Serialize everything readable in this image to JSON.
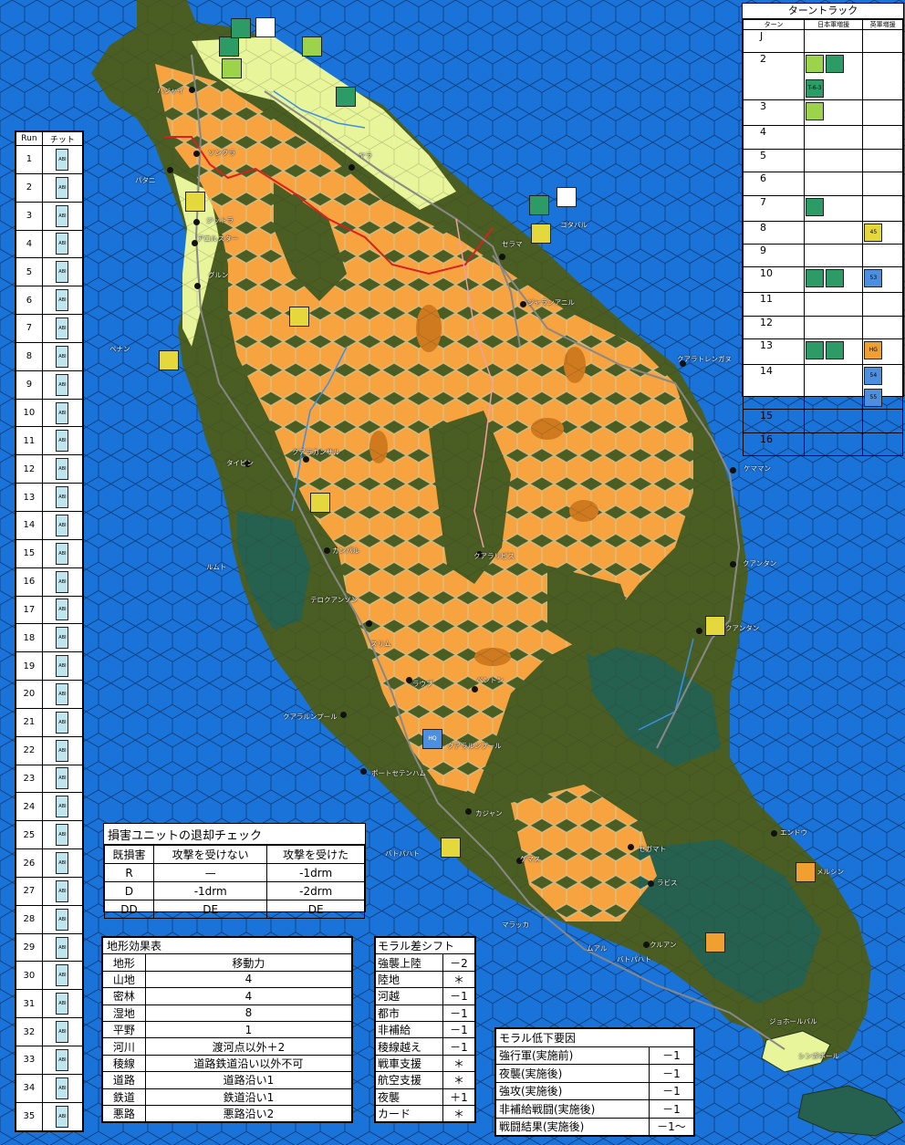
{
  "colors": {
    "sea": "#1a73d9",
    "jungle": "#4a5d23",
    "dense": "#26604e",
    "open": "#e8f59a",
    "mountain": "#f7a340",
    "ridge": "#d07a1f"
  },
  "run_table": {
    "header_run": "Run",
    "header_chit": "チット",
    "chit_label": "ABI",
    "rows": [
      "1",
      "2",
      "3",
      "4",
      "5",
      "6",
      "7",
      "8",
      "9",
      "10",
      "11",
      "12",
      "13",
      "14",
      "15",
      "16",
      "17",
      "18",
      "19",
      "20",
      "21",
      "22",
      "23",
      "24",
      "25",
      "26",
      "27",
      "28",
      "29",
      "30",
      "31",
      "32",
      "33",
      "34",
      "35"
    ]
  },
  "turn_track": {
    "title": "ターントラック",
    "headers": [
      "ターン",
      "日本軍増援",
      "英軍増援"
    ],
    "turns": [
      "J",
      "2",
      "3",
      "4",
      "5",
      "6",
      "7",
      "8",
      "9",
      "10",
      "11",
      "12",
      "13",
      "14",
      "15",
      "16"
    ],
    "units": {
      "row2_jp": [
        "T-6-3"
      ],
      "row8_uk": [
        "45"
      ],
      "row10_uk": [
        "53"
      ],
      "row13_uk": [
        "HG"
      ],
      "row14_uk": [
        "54",
        "55"
      ]
    }
  },
  "damage_chart": {
    "title": "損害ユニットの退却チェック",
    "headers": [
      "既損害",
      "攻撃を受けない",
      "攻撃を受けた"
    ],
    "rows": [
      [
        "R",
        "—",
        "-1drm"
      ],
      [
        "D",
        "-1drm",
        "-2drm"
      ],
      [
        "DD",
        "DE",
        "DE"
      ]
    ]
  },
  "terrain_chart": {
    "title": "地形効果表",
    "headers": [
      "地形",
      "移動力"
    ],
    "rows": [
      [
        "山地",
        "4"
      ],
      [
        "密林",
        "4"
      ],
      [
        "湿地",
        "8"
      ],
      [
        "平野",
        "1"
      ],
      [
        "河川",
        "渡河点以外＋2"
      ],
      [
        "稜線",
        "道路鉄道沿い以外不可"
      ],
      [
        "道路",
        "道路沿い1"
      ],
      [
        "鉄道",
        "鉄道沿い1"
      ],
      [
        "悪路",
        "悪路沿い2"
      ]
    ]
  },
  "morale_shift": {
    "title": "モラル差シフト",
    "rows": [
      [
        "強襲上陸",
        "－2"
      ],
      [
        "陸地",
        "＊"
      ],
      [
        "河越",
        "－1"
      ],
      [
        "都市",
        "－1"
      ],
      [
        "非補給",
        "－1"
      ],
      [
        "稜線越え",
        "－1"
      ],
      [
        "戦車支援",
        "＊"
      ],
      [
        "航空支援",
        "＊"
      ],
      [
        "夜襲",
        "＋1"
      ],
      [
        "カード",
        "＊"
      ]
    ]
  },
  "morale_reduction": {
    "title": "モラル低下要因",
    "rows": [
      [
        "強行軍(実施前)",
        "－1"
      ],
      [
        "夜襲(実施後)",
        "－1"
      ],
      [
        "強攻(実施後)",
        "－1"
      ],
      [
        "非補給戦闘(実施後)",
        "－1"
      ],
      [
        "戦闘結果(実施後)",
        "－1～"
      ]
    ]
  },
  "map": {
    "towns": [
      "ハジャイ",
      "ソンクラ",
      "パタニ",
      "コタバル",
      "ゲマス",
      "ジットラ",
      "アロルスター",
      "ペナン",
      "クアラカンサル",
      "タイピン",
      "イポー",
      "カンパル",
      "ルムト",
      "テロクアンソン",
      "スリム",
      "クアラルンプール",
      "ポートセテンハム",
      "マラッカ",
      "バトパハト",
      "ムアル",
      "クルアン",
      "ジョホールバル",
      "シンガポール",
      "エンドウ",
      "メルシン",
      "ラビス",
      "ゲマス",
      "セガマト",
      "カジャン",
      "ラウブ",
      "ベントン",
      "クアラリピス",
      "ダブン",
      "ウシンバル",
      "クアンタン",
      "クアラトレンガヌ",
      "ケママン",
      "トリンガン",
      "ペラク",
      "ヤラ",
      "グルン",
      "ジャランアニル",
      "セラマ",
      "ブキット"
    ],
    "hq_label": "HQ"
  }
}
